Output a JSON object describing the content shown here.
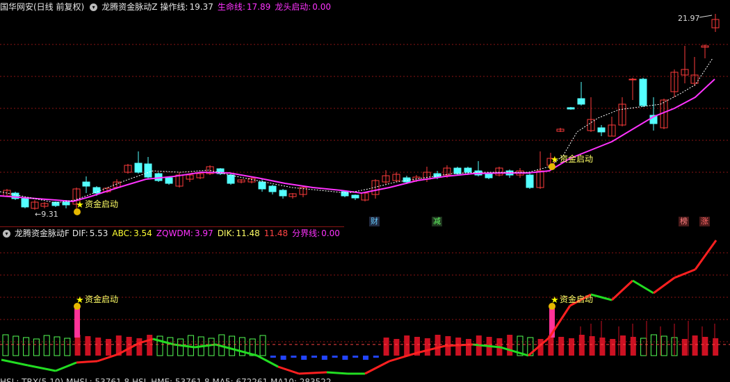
{
  "top_bar": {
    "title": "国华网安(日线 前复权)",
    "indicator_name": "龙腾资金脉动Z",
    "op_label": "操作线:",
    "op_value": "19.37",
    "life_label": "生命线:",
    "life_value": "17.89",
    "dragon_label": "龙头启动:",
    "dragon_value": "0.00"
  },
  "price_chart": {
    "high_label": "21.97",
    "low_label": "←9.31",
    "signal_label": "资金启动",
    "bottom_tags": [
      "财",
      "减",
      "榜",
      "涨"
    ],
    "colors": {
      "up": "#ff3b3b",
      "down": "#54ffff",
      "life": "#ff33ff",
      "op": "#ffffff",
      "grid": "#8b1515"
    }
  },
  "sub_bar": {
    "indicator_name": "龙腾资金脉动F",
    "dif_label": "DIF:",
    "dif_value": "5.53",
    "abc_label": "ABC:",
    "abc_value": "3.54",
    "zqwdm_label": "ZQWDM:",
    "zqwdm_value": "3.97",
    "dik_label": "DIK:",
    "dik_value": "11.48",
    "dik2_value": "11.48",
    "fj_label": "分界线:",
    "fj_value": "0.00"
  },
  "sub_chart": {
    "signal_label": "资金启动"
  },
  "bottom_bar": {
    "text": "HSL: TRX(5,10)  MHSL: 53761.8  HSL HME: 53761.8  MA5: 672261  MA10: 283522"
  }
}
